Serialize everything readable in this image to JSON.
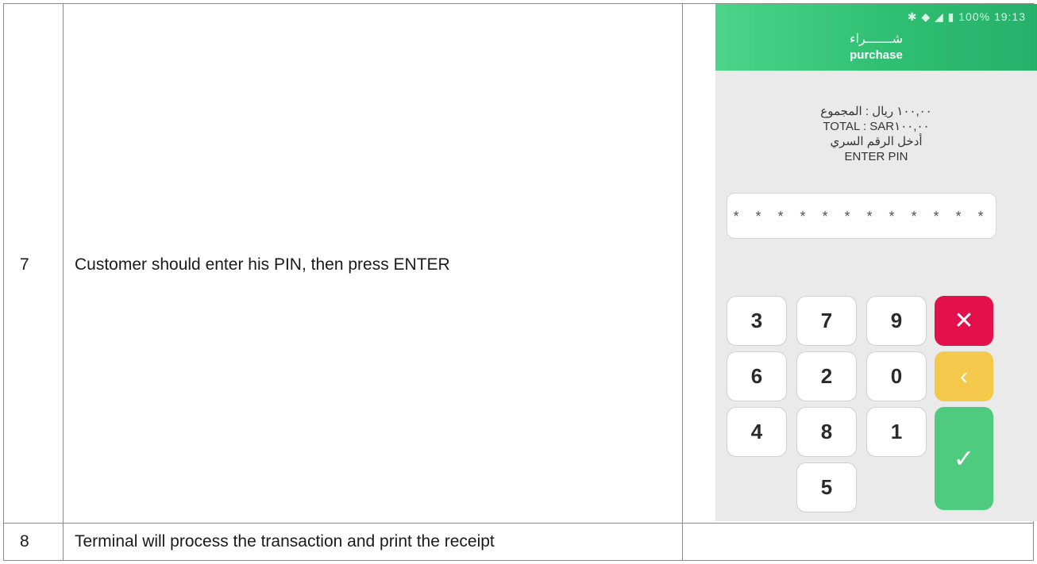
{
  "rows": [
    {
      "number": "7",
      "description": "Customer should enter his PIN, then press ENTER"
    },
    {
      "number": "8",
      "description": "Terminal will process the transaction and print the receipt"
    }
  ],
  "phone": {
    "status": {
      "battery": "100%",
      "time": "19:13",
      "icons": "✱ ◆ ◢ ▮"
    },
    "header": {
      "title_ar": "شـــــــراء",
      "title_en": "purchase"
    },
    "info": [
      "١٠٠,٠٠ ريال : المجموع",
      "TOTAL : SAR١٠٠,٠٠",
      "أدخل الرقم السري",
      "ENTER PIN"
    ],
    "pin_mask": "* * * * * * * * * * * *",
    "keys": {
      "row1": [
        "3",
        "7",
        "9"
      ],
      "row2": [
        "6",
        "2",
        "0"
      ],
      "row3": [
        "4",
        "8",
        "1"
      ],
      "row4": [
        "5"
      ]
    },
    "actions": {
      "cancel": "✕",
      "back": "‹",
      "enter": "✓"
    },
    "colors": {
      "header": "#2fbf72",
      "cancel": "#e3104c",
      "back": "#f3c84b",
      "enter": "#4ecb7e"
    }
  }
}
